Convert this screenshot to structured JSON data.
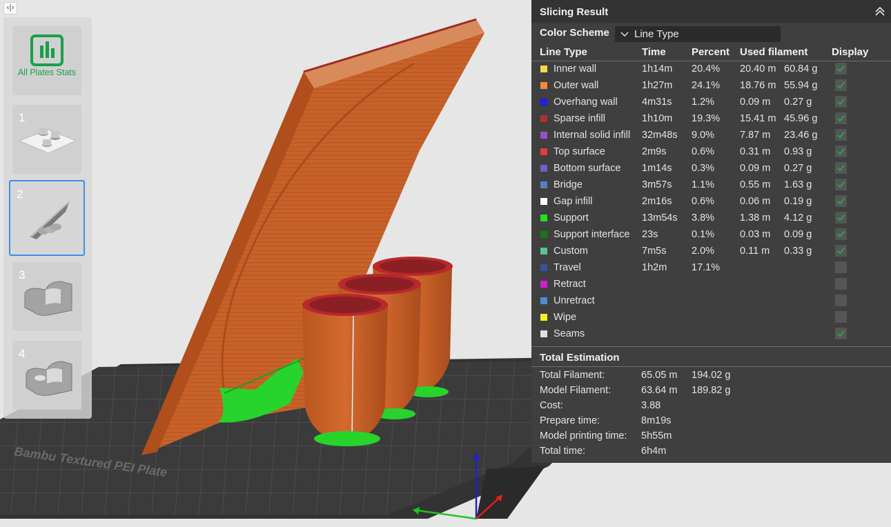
{
  "sidebar": {
    "toggle_glyph": "‹|›",
    "stats_label": "All Plates Stats",
    "plates": [
      {
        "number": "1",
        "selected": false
      },
      {
        "number": "2",
        "selected": true
      },
      {
        "number": "3",
        "selected": false
      },
      {
        "number": "4",
        "selected": false
      }
    ]
  },
  "panel": {
    "title": "Slicing Result",
    "color_scheme_label": "Color Scheme",
    "color_scheme_value": "Line Type",
    "headers": {
      "line_type": "Line Type",
      "time": "Time",
      "percent": "Percent",
      "used_filament": "Used filament",
      "display": "Display"
    },
    "rows": [
      {
        "name": "Inner wall",
        "color": "#F5D64F",
        "time": "1h14m",
        "percent": "20.4%",
        "length": "20.40 m",
        "weight": "60.84 g",
        "display": true
      },
      {
        "name": "Outer wall",
        "color": "#F08A42",
        "time": "1h27m",
        "percent": "24.1%",
        "length": "18.76 m",
        "weight": "55.94 g",
        "display": true
      },
      {
        "name": "Overhang wall",
        "color": "#1E1EF0",
        "time": "4m31s",
        "percent": "1.2%",
        "length": "0.09 m",
        "weight": "0.27 g",
        "display": true
      },
      {
        "name": "Sparse infill",
        "color": "#B52E2E",
        "time": "1h10m",
        "percent": "19.3%",
        "length": "15.41 m",
        "weight": "45.96 g",
        "display": true
      },
      {
        "name": "Internal solid infill",
        "color": "#9A4FC7",
        "time": "32m48s",
        "percent": "9.0%",
        "length": "7.87 m",
        "weight": "23.46 g",
        "display": true
      },
      {
        "name": "Top surface",
        "color": "#E83A3A",
        "time": "2m9s",
        "percent": "0.6%",
        "length": "0.31 m",
        "weight": "0.93 g",
        "display": true
      },
      {
        "name": "Bottom surface",
        "color": "#6B63C9",
        "time": "1m14s",
        "percent": "0.3%",
        "length": "0.09 m",
        "weight": "0.27 g",
        "display": true
      },
      {
        "name": "Bridge",
        "color": "#5A7EC2",
        "time": "3m57s",
        "percent": "1.1%",
        "length": "0.55 m",
        "weight": "1.63 g",
        "display": true
      },
      {
        "name": "Gap infill",
        "color": "#FFFFFF",
        "time": "2m16s",
        "percent": "0.6%",
        "length": "0.06 m",
        "weight": "0.19 g",
        "display": true
      },
      {
        "name": "Support",
        "color": "#22E022",
        "time": "13m54s",
        "percent": "3.8%",
        "length": "1.38 m",
        "weight": "4.12 g",
        "display": true
      },
      {
        "name": "Support interface",
        "color": "#137A13",
        "time": "23s",
        "percent": "0.1%",
        "length": "0.03 m",
        "weight": "0.09 g",
        "display": true
      },
      {
        "name": "Custom",
        "color": "#5CC28E",
        "time": "7m5s",
        "percent": "2.0%",
        "length": "0.11 m",
        "weight": "0.33 g",
        "display": true
      },
      {
        "name": "Travel",
        "color": "#3A4FA3",
        "time": "1h2m",
        "percent": "17.1%",
        "length": "",
        "weight": "",
        "display": false
      },
      {
        "name": "Retract",
        "color": "#D11FD1",
        "time": "",
        "percent": "",
        "length": "",
        "weight": "",
        "display": false
      },
      {
        "name": "Unretract",
        "color": "#4A8FD4",
        "time": "",
        "percent": "",
        "length": "",
        "weight": "",
        "display": false
      },
      {
        "name": "Wipe",
        "color": "#F2F21F",
        "time": "",
        "percent": "",
        "length": "",
        "weight": "",
        "display": false
      },
      {
        "name": "Seams",
        "color": "#E0E0E0",
        "time": "",
        "percent": "",
        "length": "",
        "weight": "",
        "display": true
      }
    ],
    "total_estimation_title": "Total Estimation",
    "estimation": [
      {
        "label": "Total Filament:",
        "v1": "65.05 m",
        "v2": "194.02 g"
      },
      {
        "label": "Model Filament:",
        "v1": "63.64 m",
        "v2": "189.82 g"
      },
      {
        "label": "Cost:",
        "v1": "3.88",
        "v2": ""
      },
      {
        "label": "Prepare time:",
        "v1": "8m19s",
        "v2": ""
      },
      {
        "label": "Model printing time:",
        "v1": "5h55m",
        "v2": ""
      },
      {
        "label": "Total time:",
        "v1": "6h4m",
        "v2": ""
      }
    ]
  },
  "scene": {
    "plate_text": "Bambu Textured PEI Plate",
    "colors": {
      "background": "#e6e6e6",
      "bed": "#3a3a3a",
      "model_orange": "#c8622a",
      "top_red": "#b8282c",
      "support_green": "#27d42c",
      "accent_green": "#18a04a",
      "selection_blue": "#3a8ee6"
    }
  }
}
